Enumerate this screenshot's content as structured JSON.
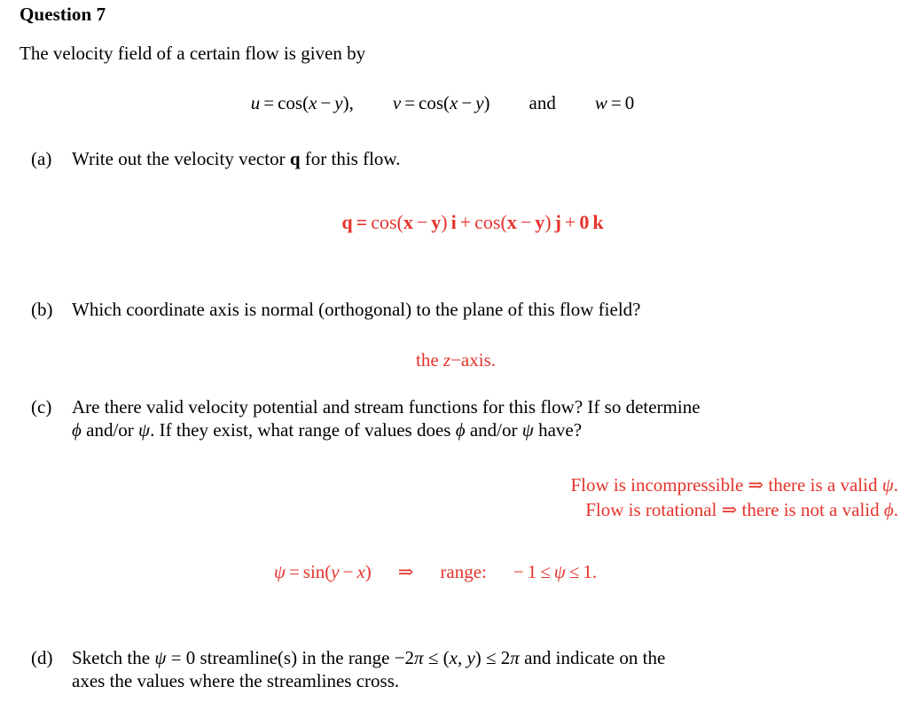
{
  "document": {
    "title": "Question 7",
    "intro": "The velocity field of a certain flow is given by",
    "accent_color": "#e5332b",
    "text_color": "#000000",
    "background_color": "#ffffff"
  },
  "equation_main": {
    "u_lhs": "u",
    "eq": "=",
    "cos": "cos",
    "open": "(",
    "x": "x",
    "minus": "−",
    "y": "y",
    "close": ")",
    "comma": ",",
    "v_lhs": "v",
    "and": "and",
    "w_lhs": "w",
    "zero": "0",
    "full_text": "u = cos(x − y),    v = cos(x − y)    and    w = 0"
  },
  "parts": [
    {
      "marker": "(a)",
      "text_before_vec": "Write out the velocity vector ",
      "vector_symbol": "q",
      "text_after_vec": " for this flow."
    },
    {
      "marker": "(b)",
      "text": "Which coordinate axis is normal (orthogonal) to the plane of this flow field?"
    },
    {
      "marker": "(c)",
      "line1": "Are there valid velocity potential and stream functions for this flow? If so determine",
      "line2_a": " and/or ",
      "line2_b": ". If they exist, what range of values does ",
      "line2_c": " and/or ",
      "line2_d": " have?",
      "phi": "ϕ",
      "psi": "ψ"
    },
    {
      "marker": "(d)",
      "line1_a": "Sketch the ",
      "line1_psi": "ψ",
      "line1_b": " = 0 streamline(s) in the range −2",
      "line1_pi": "π",
      "line1_c": " ≤ (",
      "line1_x": "x",
      "line1_comma": ", ",
      "line1_y": "y",
      "line1_d": ") ≤ 2",
      "line1_pi2": "π",
      "line1_e": " and indicate on the",
      "line2": "axes the values where the streamlines cross."
    }
  ],
  "answers": {
    "a": {
      "q": "q",
      "eq": "=",
      "cos": "cos",
      "open": "(",
      "x": "x",
      "minus": "−",
      "y": "y",
      "close": ")",
      "i": "i",
      "plus": "+",
      "j": "j",
      "zero": "0",
      "k": "k",
      "full_text": "q = cos(x − y) i + cos(x − y) j + 0 k"
    },
    "b": {
      "the": "the ",
      "z": "z",
      "dash": "−",
      "axis": "axis.",
      "full_text": "the z−axis."
    },
    "c": {
      "line1_a": "Flow is incompressible ",
      "line1_arrow": "⇒",
      "line1_b": " there is a valid ",
      "line1_psi": "ψ",
      "line1_period": ".",
      "line2_a": "Flow is rotational ",
      "line2_arrow": "⇒",
      "line2_b": " there is not a valid ",
      "line2_phi": "ϕ",
      "line2_period": ".",
      "psi_eq": {
        "psi": "ψ",
        "eq": "=",
        "sin": "sin",
        "open": "(",
        "y": "y",
        "minus": "−",
        "x": "x",
        "close": ")",
        "arrow": "⇒",
        "range_label": "range:",
        "neg": "−",
        "one": "1",
        "le1": "≤",
        "psi2": "ψ",
        "le2": "≤",
        "one2": "1",
        "period": ".",
        "full_text": "ψ = sin(y − x)  ⇒  range:  −1 ≤ ψ ≤ 1."
      }
    }
  }
}
